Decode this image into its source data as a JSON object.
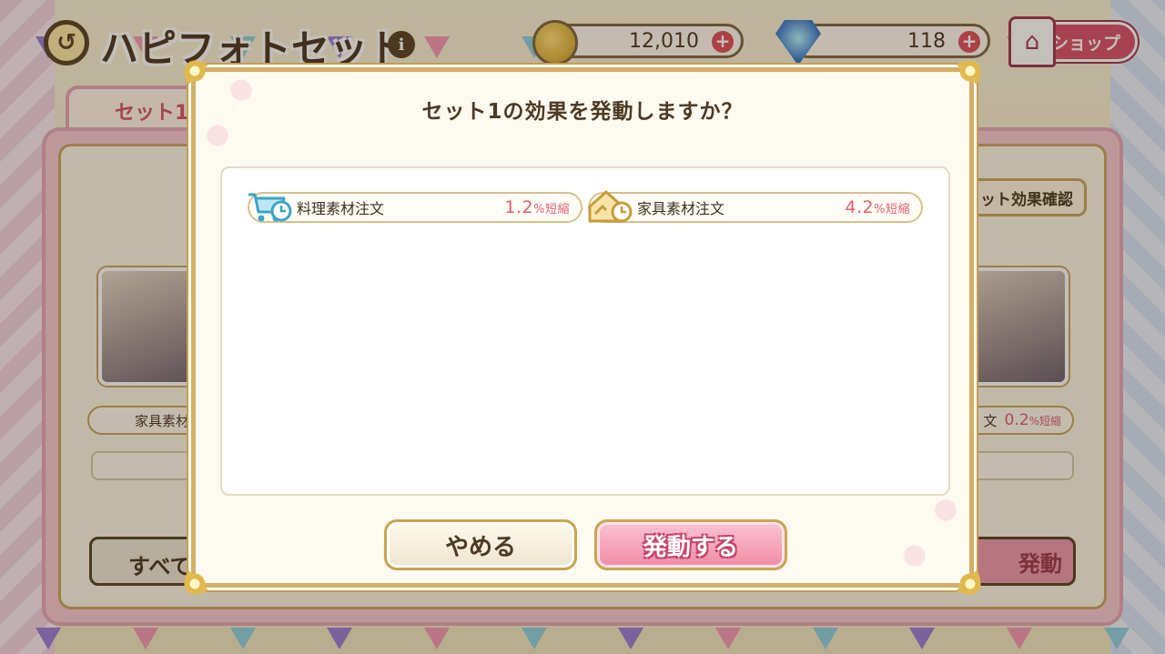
{
  "header": {
    "title": "ハピフォトセット",
    "coins": "12,010",
    "gems": "118",
    "shop_label": "ショップ"
  },
  "background": {
    "set_tab_label": "セット1",
    "left_effect_name": "家具素材",
    "right_effect_tail": "文",
    "right_effect_value": "0.2",
    "right_effect_unit": "%短縮",
    "all_button_label": "すべて",
    "activate_button_label": "発動",
    "confirm_button_label": "ット効果確認"
  },
  "dialog": {
    "title": "セット1の効果を発動しますか？",
    "effects": [
      {
        "icon": "cart-clock-icon",
        "name": "料理素材注文",
        "value": "1.2",
        "unit": "%短縮"
      },
      {
        "icon": "house-clock-icon",
        "name": "家具素材注文",
        "value": "4.2",
        "unit": "%短縮"
      }
    ],
    "cancel_label": "やめる",
    "activate_label": "発動する"
  },
  "colors": {
    "accent_pink": "#ef8aa6",
    "gold_border": "#d4b065",
    "value_red": "#e0606e",
    "text_brown": "#4e3a23"
  }
}
